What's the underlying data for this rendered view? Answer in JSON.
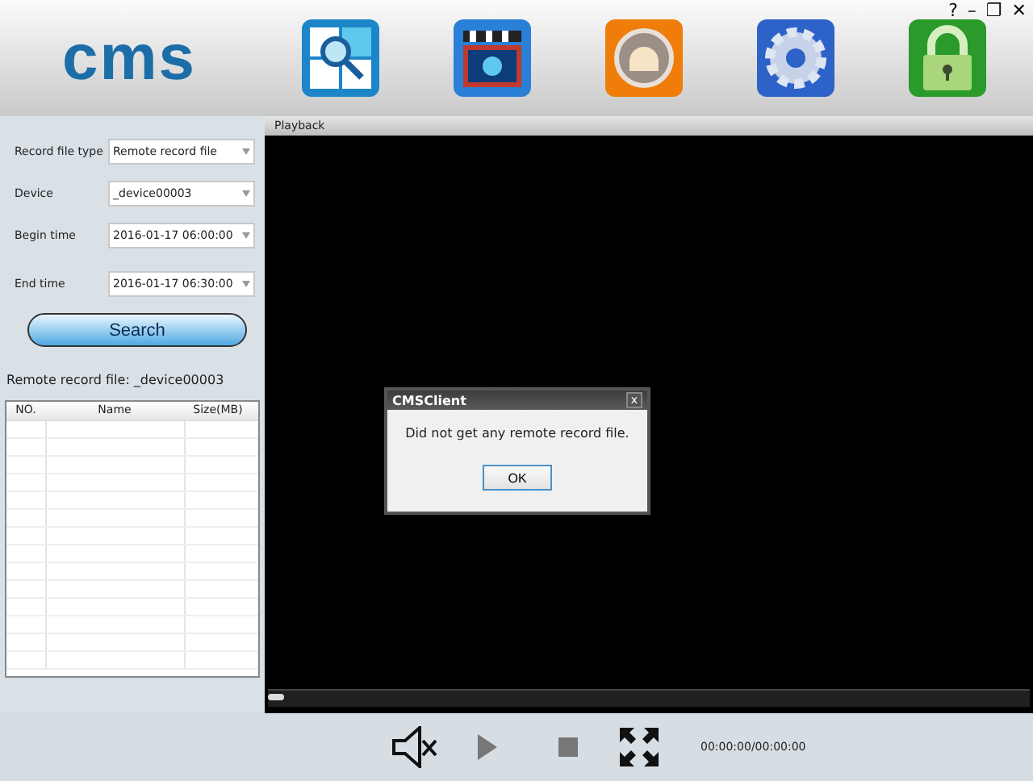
{
  "window_controls": [
    "?",
    "–",
    "❐",
    "✕"
  ],
  "logo": "cms",
  "toolbar": [
    {
      "kind": "search"
    },
    {
      "kind": "playback"
    },
    {
      "kind": "alarm"
    },
    {
      "kind": "settings"
    },
    {
      "kind": "lock"
    }
  ],
  "filters": [
    {
      "label": "Record file type",
      "value": "Remote record file"
    },
    {
      "label": "Device",
      "value": "_device00003"
    },
    {
      "label": "Begin time",
      "value": "2016-01-17 06:00:00"
    },
    {
      "label": "End time",
      "value": "2016-01-17 06:30:00"
    }
  ],
  "search_button": "Search",
  "result_label": "Remote record file: _device00003",
  "table": {
    "columns": [
      "NO.",
      "Name",
      "Size(MB)"
    ]
  },
  "panel_title": "Playback",
  "dialog": {
    "title": "CMSClient",
    "close": "x",
    "message": "Did not get any remote record file.",
    "button": "OK"
  },
  "progress": {
    "level": 0
  },
  "time": "00:00:00/00:00:00"
}
